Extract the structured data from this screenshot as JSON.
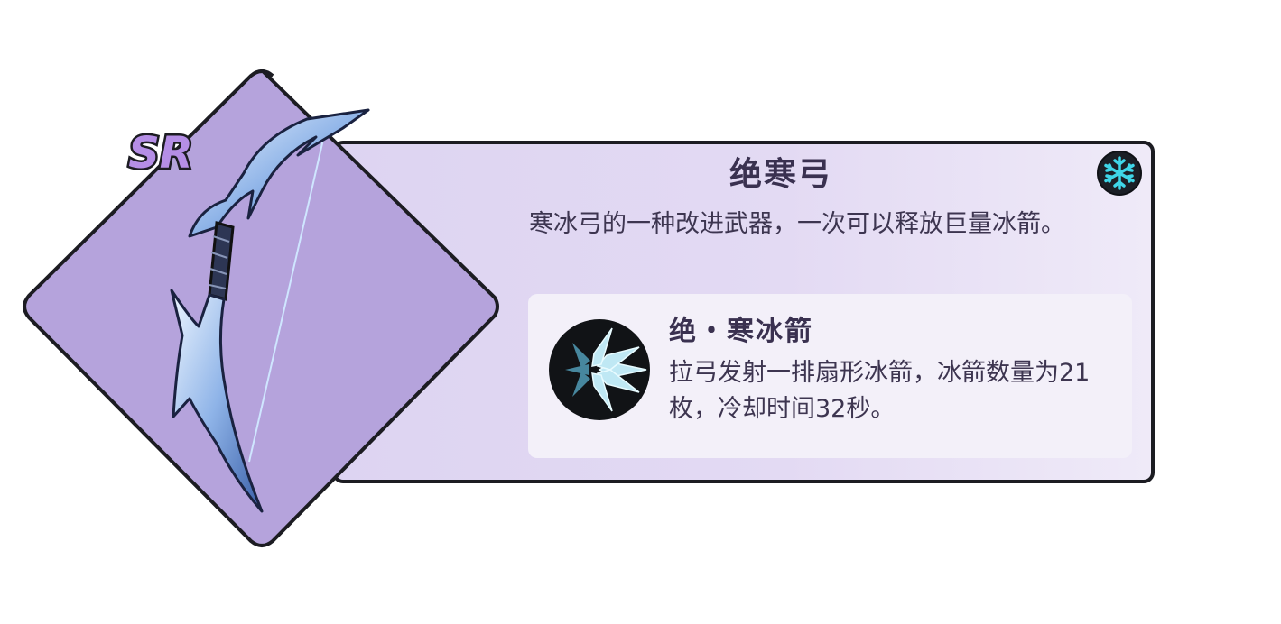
{
  "weapon": {
    "name": "绝寒弓",
    "description": "寒冰弓的一种改进武器，一次可以释放巨量冰箭。",
    "rarity": "SR",
    "element_icon": "snowflake-icon",
    "image": "ice-bow-icon"
  },
  "skill": {
    "name": "绝・寒冰箭",
    "description": "拉弓发射一排扇形冰箭，冰箭数量为21枚，冷却时间32秒。",
    "icon": "ice-arrows-icon"
  },
  "colors": {
    "diamond": "#b5a3dc",
    "card_bg": "#ddd4f2",
    "border": "#1c1c22",
    "text": "#3d3550",
    "element_accent": "#3fd6e8"
  }
}
